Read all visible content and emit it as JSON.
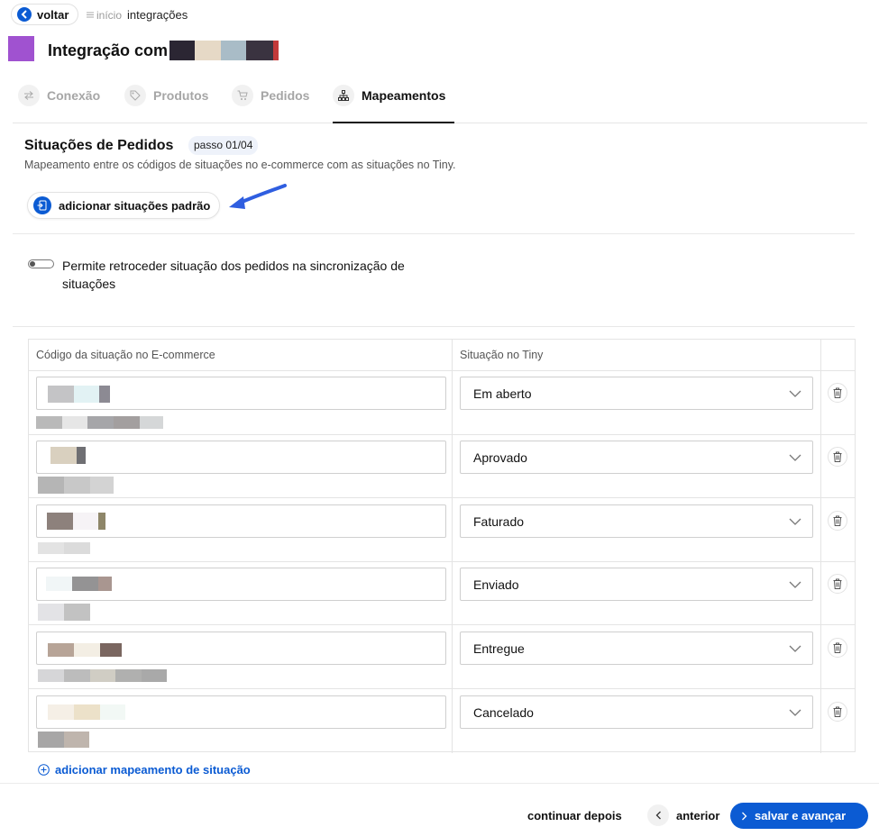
{
  "topbar": {
    "back_label": "voltar",
    "breadcrumb_home": "início",
    "breadcrumb_current": "integrações"
  },
  "header": {
    "title": "Integração com",
    "logo_color": "#a052d0"
  },
  "tabs": [
    {
      "label": "Conexão",
      "icon": "arrows-swap-icon",
      "active": false
    },
    {
      "label": "Produtos",
      "icon": "tag-icon",
      "active": false
    },
    {
      "label": "Pedidos",
      "icon": "cart-icon",
      "active": false
    },
    {
      "label": "Mapeamentos",
      "icon": "sitemap-icon",
      "active": true
    }
  ],
  "section": {
    "title": "Situações de Pedidos",
    "step": "passo 01/04",
    "description": "Mapeamento entre os códigos de situações no e-commerce com as situações no Tiny.",
    "add_default_label": "adicionar situações padrão"
  },
  "toggle": {
    "label": "Permite retroceder situação dos pedidos na sincronização de situações",
    "on": false
  },
  "table": {
    "col_code": "Código da situação no E-commerce",
    "col_tiny": "Situação no Tiny",
    "rows": [
      {
        "tiny_status": "Em aberto"
      },
      {
        "tiny_status": "Aprovado"
      },
      {
        "tiny_status": "Faturado"
      },
      {
        "tiny_status": "Enviado"
      },
      {
        "tiny_status": "Entregue"
      },
      {
        "tiny_status": "Cancelado"
      }
    ]
  },
  "add_mapping_label": "adicionar mapeamento de situação",
  "footer": {
    "later_label": "continuar depois",
    "prev_label": "anterior",
    "save_label": "salvar e avançar"
  },
  "colors": {
    "primary": "#0b5bd3",
    "accent_logo": "#a052d0"
  }
}
